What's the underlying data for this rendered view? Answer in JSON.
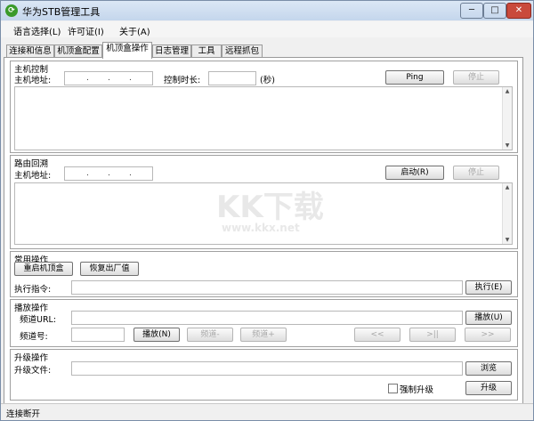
{
  "window": {
    "title": "华为STB管理工具",
    "controls": {
      "minimize": "─",
      "maximize": "□",
      "close": "✕"
    }
  },
  "menu": [
    "语言选择(L)",
    "许可证(I)",
    "关于(A)"
  ],
  "tabs": [
    "连接和信息",
    "机顶盒配置",
    "机顶盒操作",
    "日志管理",
    "工具",
    "远程抓包"
  ],
  "host_control": {
    "title": "主机控制",
    "host_label": "主机地址:",
    "ip_dots": ". . .",
    "duration_label": "控制时长:",
    "unit": "(秒)",
    "ping_button": "Ping",
    "stop_button": "停止"
  },
  "route_trace": {
    "title": "路由回溯",
    "host_label": "主机地址:",
    "ip_dots": ". . .",
    "start_button": "启动(R)",
    "stop_button": "停止"
  },
  "common_ops": {
    "title": "常用操作",
    "reboot_button": "重启机顶盒",
    "factory_reset_button": "恢复出厂值",
    "command_label": "执行指令:",
    "execute_button": "执行(E)"
  },
  "playback": {
    "title": "播放操作",
    "url_label": "频道URL:",
    "play_url_button": "播放(U)",
    "channel_label": "频道号:",
    "play_button": "播放(N)",
    "channel_down_button": "频道-",
    "channel_up_button": "频道+",
    "prev_button": "<<",
    "pause_button": ">||",
    "next_button": ">>"
  },
  "upgrade": {
    "title": "升级操作",
    "file_label": "升级文件:",
    "browse_button": "浏览",
    "force_label": "强制升级",
    "upgrade_button": "升级"
  },
  "status": "连接断开",
  "watermark": {
    "logo": "KK下载",
    "url": "www.kkx.net"
  }
}
